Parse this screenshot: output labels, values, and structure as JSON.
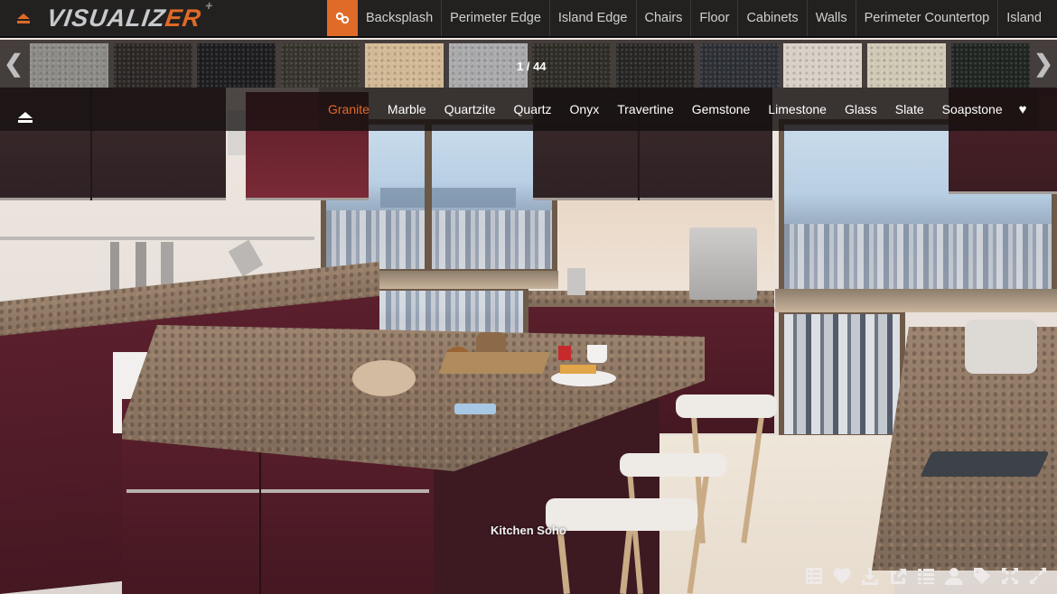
{
  "app": {
    "logo_text": "VISUALIZ",
    "logo_accent": "ER",
    "logo_plus": "+",
    "accent_color": "#e06a28",
    "collapse_icon": "eject-icon"
  },
  "top_nav": {
    "link_button_icon": "chain-link-icon",
    "items": [
      {
        "label": "Backsplash"
      },
      {
        "label": "Perimeter Edge"
      },
      {
        "label": "Island Edge"
      },
      {
        "label": "Chairs"
      },
      {
        "label": "Floor"
      },
      {
        "label": "Cabinets"
      },
      {
        "label": "Walls"
      },
      {
        "label": "Perimeter Countertop"
      },
      {
        "label": "Island"
      }
    ]
  },
  "thumbnail_strip": {
    "prev_glyph": "❮",
    "next_glyph": "❯",
    "counter": "1 / 44",
    "current": 1,
    "total": 44,
    "swatches": [
      {
        "color": "#8c8a86"
      },
      {
        "color": "#2a2624"
      },
      {
        "color": "#1c1b1d"
      },
      {
        "color": "#36332c"
      },
      {
        "color": "#d2b894"
      },
      {
        "color": "#a9a9ab"
      },
      {
        "color": "#2e2c25"
      },
      {
        "color": "#262524"
      },
      {
        "color": "#2c2f35"
      },
      {
        "color": "#d8d0c6"
      },
      {
        "color": "#cfc8b4"
      },
      {
        "color": "#1f2420"
      }
    ]
  },
  "materials": {
    "items": [
      {
        "label": "Granite",
        "active": true
      },
      {
        "label": "Marble"
      },
      {
        "label": "Quartzite"
      },
      {
        "label": "Quartz"
      },
      {
        "label": "Onyx"
      },
      {
        "label": "Travertine"
      },
      {
        "label": "Gemstone"
      },
      {
        "label": "Limestone"
      },
      {
        "label": "Glass"
      },
      {
        "label": "Slate"
      },
      {
        "label": "Soapstone"
      }
    ],
    "favorites_glyph": "♥"
  },
  "scene": {
    "caption": "Kitchen Soho"
  },
  "toolbar": {
    "icons": [
      "list-details-icon",
      "heart-icon",
      "download-icon",
      "share-icon",
      "list-icon",
      "user-icon",
      "tag-icon",
      "fullscreen-icon",
      "fullscreen-alt-icon"
    ]
  }
}
